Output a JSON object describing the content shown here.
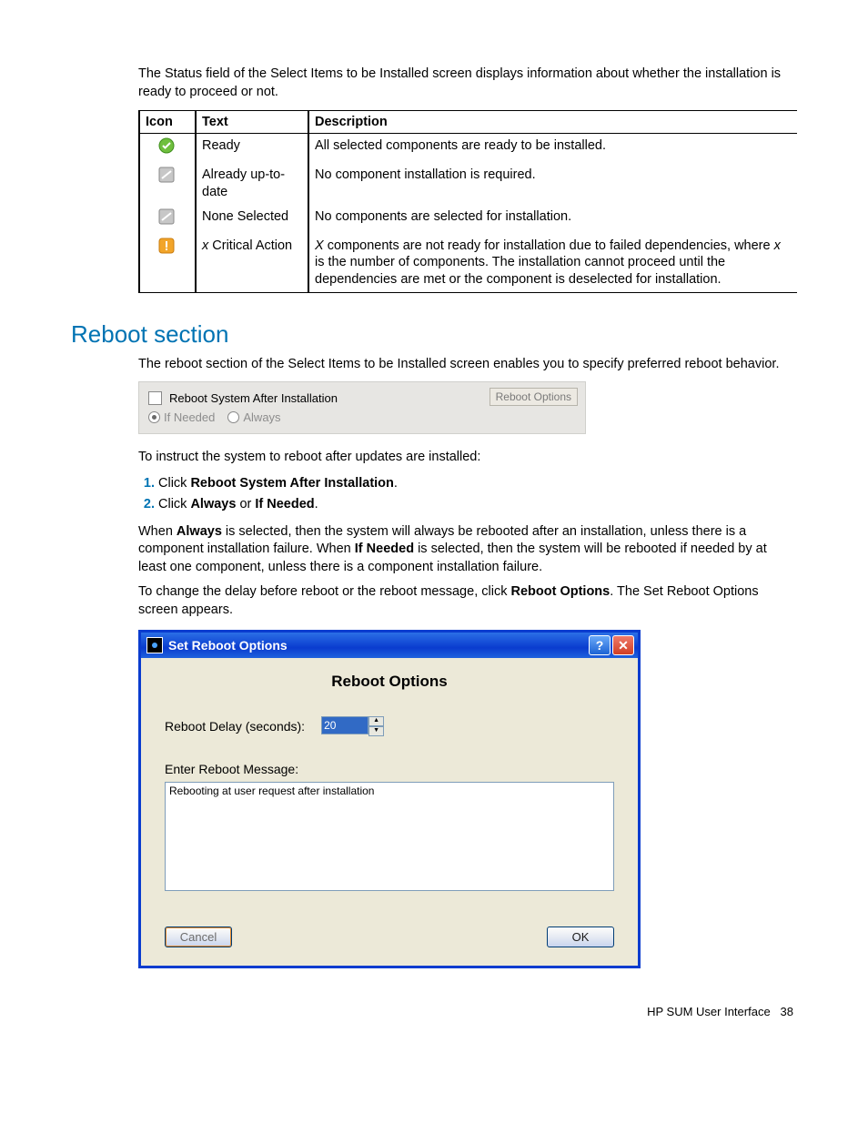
{
  "intro": "The Status field of the Select Items to be Installed screen displays information about whether the installation is ready to proceed or not.",
  "status_table": {
    "headers": {
      "icon": "Icon",
      "text": "Text",
      "desc": "Description"
    },
    "rows": [
      {
        "text": "Ready",
        "desc": "All selected components are ready to be installed."
      },
      {
        "text": "Already up-to-date",
        "desc": "No component installation is required."
      },
      {
        "text": "None Selected",
        "desc": "No components are selected for installation."
      },
      {
        "text_prefix": "x",
        "text_rest": " Critical Action",
        "desc_prefix": "X",
        "desc_rest1": " components are not ready for installation due to failed dependencies, where ",
        "desc_var": "x",
        "desc_rest2": " is the number of components. The installation cannot proceed until the dependencies are met or the component is deselected for installation."
      }
    ]
  },
  "section_heading": "Reboot section",
  "section_intro": "The reboot section of the Select Items to be Installed screen enables you to specify preferred reboot behavior.",
  "reboot_panel": {
    "checkbox_label": "Reboot System After Installation",
    "radio_if": "If Needed",
    "radio_always": "Always",
    "options_btn": "Reboot Options"
  },
  "instruct": "To instruct the system to reboot after updates are installed:",
  "steps": {
    "s1a": "Click ",
    "s1b": "Reboot System After Installation",
    "s1c": ".",
    "s2a": "Click ",
    "s2b": "Always",
    "s2c": " or ",
    "s2d": "If Needed",
    "s2e": "."
  },
  "para1": {
    "a": "When ",
    "b": "Always",
    "c": " is selected, then the system will always be rebooted after an installation, unless there is a component installation failure. When ",
    "d": "If Needed",
    "e": " is selected, then the system will be rebooted if needed by at least one component, unless there is a component installation failure."
  },
  "para2": {
    "a": "To change the delay before reboot or the reboot message, click ",
    "b": "Reboot Options",
    "c": ". The Set Reboot Options screen appears."
  },
  "dialog": {
    "title": "Set Reboot Options",
    "heading": "Reboot Options",
    "delay_label": "Reboot Delay (seconds):",
    "delay_value": "20",
    "msg_label": "Enter Reboot Message:",
    "msg_value": "Rebooting at user request after installation",
    "cancel": "Cancel",
    "ok": "OK"
  },
  "footer": {
    "label": "HP SUM User Interface",
    "page": "38"
  }
}
